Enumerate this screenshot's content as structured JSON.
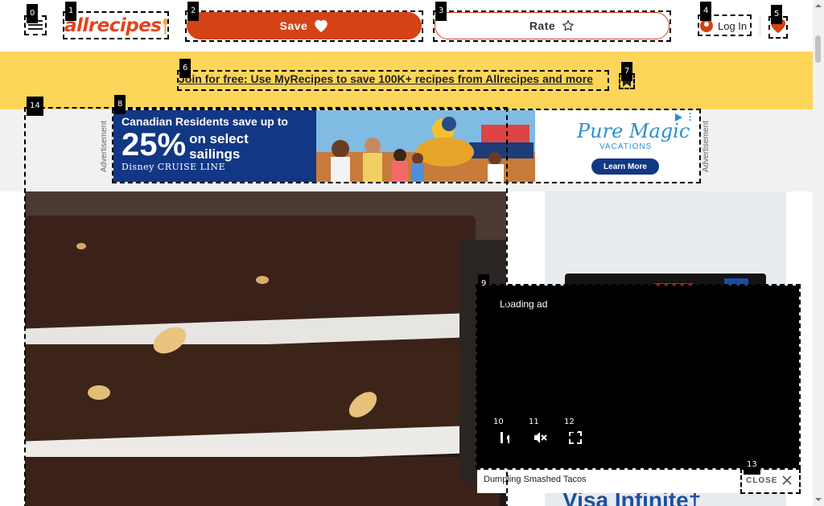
{
  "header": {
    "logo_text": "allrecipes",
    "save_label": "Save",
    "rate_label": "Rate",
    "login_label": "Log In"
  },
  "banner": {
    "link_text": "Join for free: Use MyRecipes to save 100K+ recipes from Allrecipes and more"
  },
  "ad_strip": {
    "label_left": "Advertisement",
    "label_right": "Advertisement",
    "banner": {
      "headline_line1": "Canadian Residents save up to",
      "percent": "25%",
      "headline_line2a": "on select",
      "headline_line2b": "sailings",
      "brand": "Disney CRUISE LINE",
      "partner_title": "Pure Magic",
      "partner_subtitle": "VACATIONS",
      "cta": "Learn More"
    }
  },
  "rail_ad": {
    "visa_text": "Visa Infinite†"
  },
  "video": {
    "loading_text": "Loading ad",
    "title": "Dumpling Smashed Tacos",
    "close_label": "CLOSE"
  },
  "som_marks": [
    "0",
    "1",
    "2",
    "3",
    "4",
    "5",
    "6",
    "7",
    "8",
    "9",
    "10",
    "11",
    "12",
    "13",
    "14"
  ],
  "colors": {
    "brand_red": "#d54215",
    "banner_yellow": "#fcd559",
    "ad_navy": "#123785",
    "partner_blue": "#2b8ecf"
  },
  "icons": {
    "menu": "hamburger-menu-icon",
    "save": "heart-icon",
    "rate": "star-icon",
    "account": "user-icon",
    "favorites": "heart-filled-icon",
    "banner_close": "bookmark-icon",
    "pause": "pause-icon",
    "mute": "volume-mute-icon",
    "fullscreen": "fullscreen-icon",
    "close": "close-x-icon"
  }
}
